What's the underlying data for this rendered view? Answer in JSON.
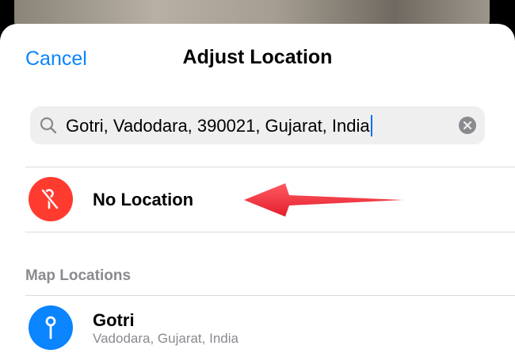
{
  "nav": {
    "cancel_label": "Cancel",
    "title": "Adjust Location"
  },
  "search": {
    "value": "Gotri, Vadodara, 390021, Gujarat, India",
    "search_icon": "magnifyingglass-icon",
    "clear_icon": "xmark-circle-fill-icon"
  },
  "no_location": {
    "label": "No Location",
    "icon": "location-slash-icon",
    "icon_color": "#ff3b30"
  },
  "map_locations": {
    "header": "Map Locations",
    "items": [
      {
        "title": "Gotri",
        "subtitle": "Vadodara, Gujarat, India",
        "icon": "map-pin-icon",
        "icon_color": "#0a84ff"
      }
    ]
  },
  "annotation": {
    "arrow_color": "#f0313c",
    "arrow_icon": "red-arrow-pointing-left"
  },
  "colors": {
    "accent": "#0a84ff",
    "secondary_text": "#8a8a8f",
    "search_bg": "#efeff0"
  }
}
